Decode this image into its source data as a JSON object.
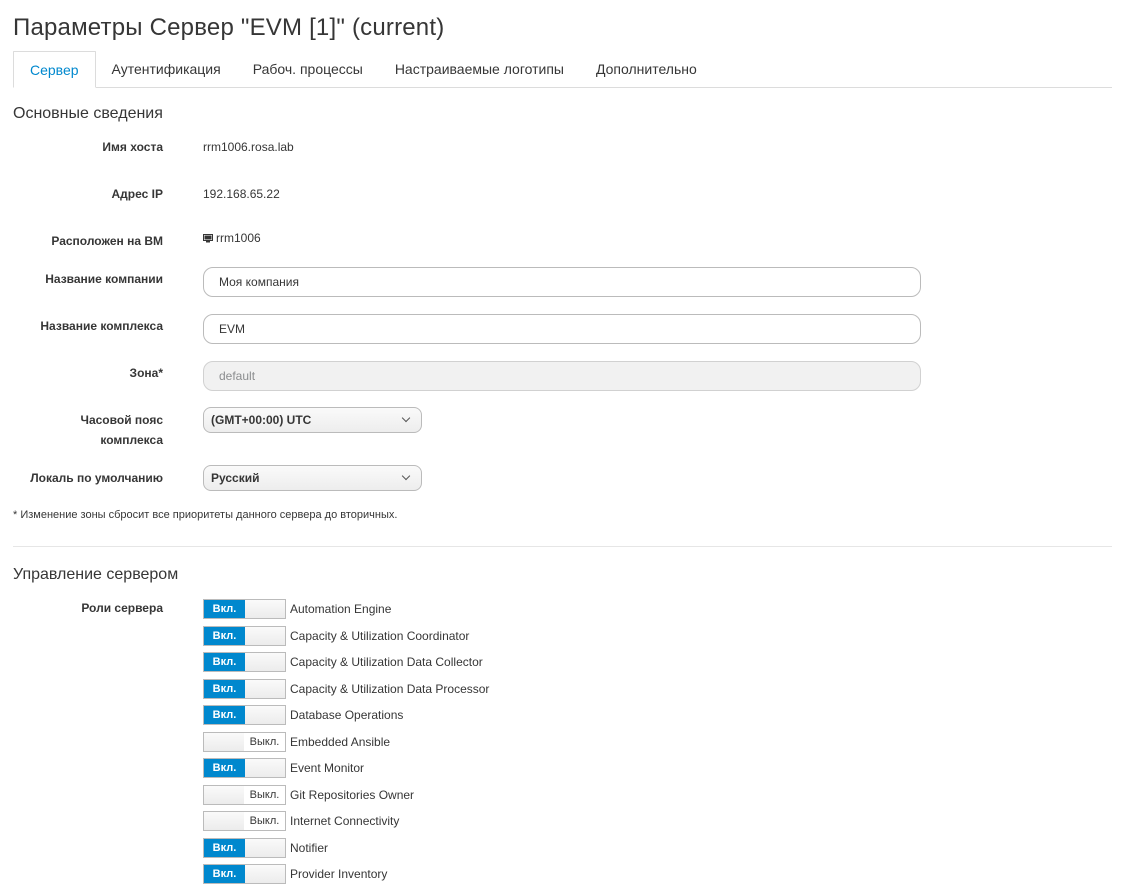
{
  "title": "Параметры Сервер \"EVM [1]\" (current)",
  "tabs": [
    {
      "label": "Сервер",
      "active": true
    },
    {
      "label": "Аутентификация",
      "active": false
    },
    {
      "label": "Рабоч. процессы",
      "active": false
    },
    {
      "label": "Настраиваемые логотипы",
      "active": false
    },
    {
      "label": "Дополнительно",
      "active": false
    }
  ],
  "basic": {
    "heading": "Основные сведения",
    "hostname_label": "Имя хоста",
    "hostname": "rrm1006.rosa.lab",
    "ip_label": "Адрес IP",
    "ip": "192.168.65.22",
    "vm_label": "Расположен на ВМ",
    "vm": "rrm1006",
    "company_label": "Название компании",
    "company": "Моя компания",
    "appliance_label": "Название комплекса",
    "appliance": "EVM",
    "zone_label": "Зона*",
    "zone": "default",
    "tz_label_line1": "Часовой пояс",
    "tz_label_line2": "комплекса",
    "tz": "(GMT+00:00) UTC",
    "locale_label": "Локаль по умолчанию",
    "locale": "Русский",
    "note": "* Изменение зоны сбросит все приоритеты данного сервера до вторичных."
  },
  "control": {
    "heading": "Управление сервером",
    "roles_label": "Роли сервера",
    "on_text": "Вкл.",
    "off_text": "Выкл.",
    "roles": [
      {
        "name": "Automation Engine",
        "on": true
      },
      {
        "name": "Capacity & Utilization Coordinator",
        "on": true
      },
      {
        "name": "Capacity & Utilization Data Collector",
        "on": true
      },
      {
        "name": "Capacity & Utilization Data Processor",
        "on": true
      },
      {
        "name": "Database Operations",
        "on": true
      },
      {
        "name": "Embedded Ansible",
        "on": false
      },
      {
        "name": "Event Monitor",
        "on": true
      },
      {
        "name": "Git Repositories Owner",
        "on": false
      },
      {
        "name": "Internet Connectivity",
        "on": false
      },
      {
        "name": "Notifier",
        "on": true
      },
      {
        "name": "Provider Inventory",
        "on": true
      }
    ]
  },
  "colors": {
    "accent": "#0088ce"
  }
}
